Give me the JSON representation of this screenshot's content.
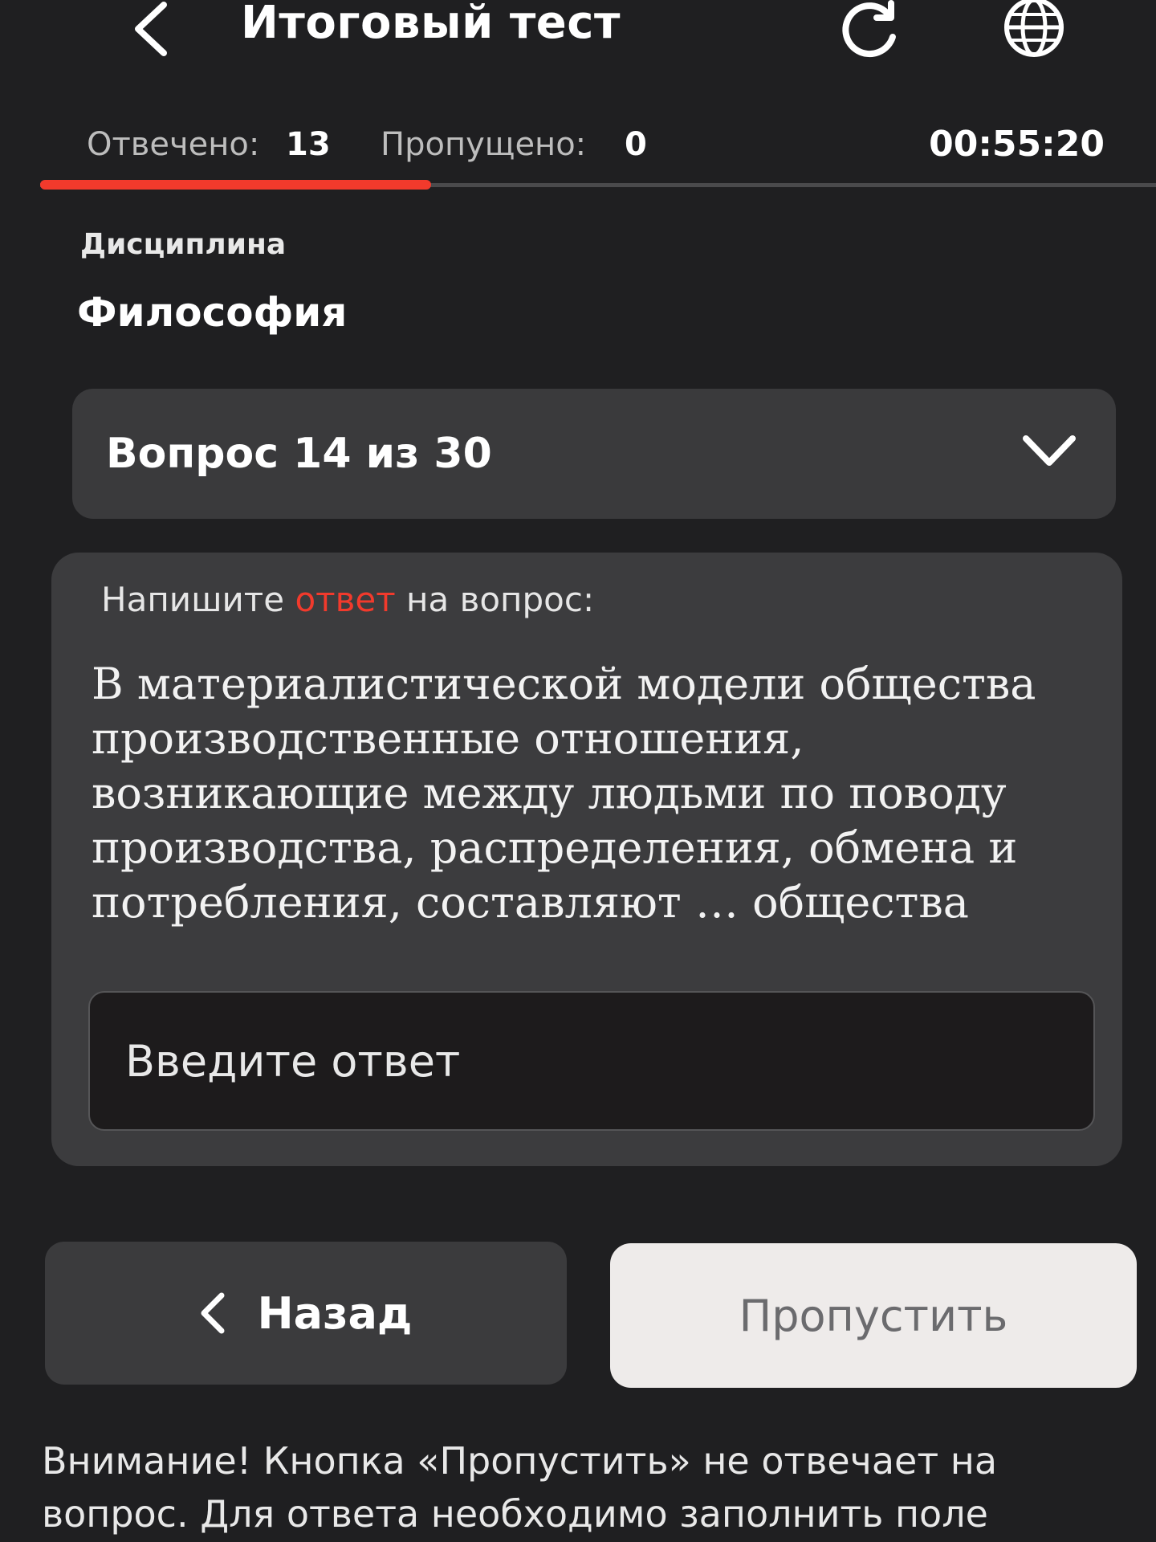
{
  "header": {
    "title": "Итоговый тест",
    "back_icon": "chevron-left-icon",
    "refresh_icon": "refresh-icon",
    "language_icon": "globe-icon"
  },
  "status": {
    "answered_label": "Отвечено:",
    "answered_value": "13",
    "skipped_label": "Пропущено:",
    "skipped_value": "0",
    "timer": "00:55:20",
    "progress_fraction": 0.35
  },
  "discipline": {
    "label": "Дисциплина",
    "value": "Философия"
  },
  "question_selector": {
    "label": "Вопрос 14 из 30"
  },
  "question": {
    "prompt_before": "Напишите ",
    "prompt_accent": "ответ",
    "prompt_after": " на вопрос:",
    "text": "В материалистической модели общества производственные отношения, возникающие между людьми по поводу производства, распределения, обмена и потребления, составляют … общества",
    "answer_value": "",
    "answer_placeholder": "Введите ответ"
  },
  "buttons": {
    "back_label": "Назад",
    "skip_label": "Пропустить"
  },
  "notice": {
    "text": "Внимание! Кнопка «Пропустить» не отвечает на вопрос. Для ответа необходимо заполнить поле"
  },
  "colors": {
    "accent": "#f23a2c",
    "background": "#1f1f21",
    "card": "#3c3c3e",
    "skip_button": "#eeebea"
  }
}
